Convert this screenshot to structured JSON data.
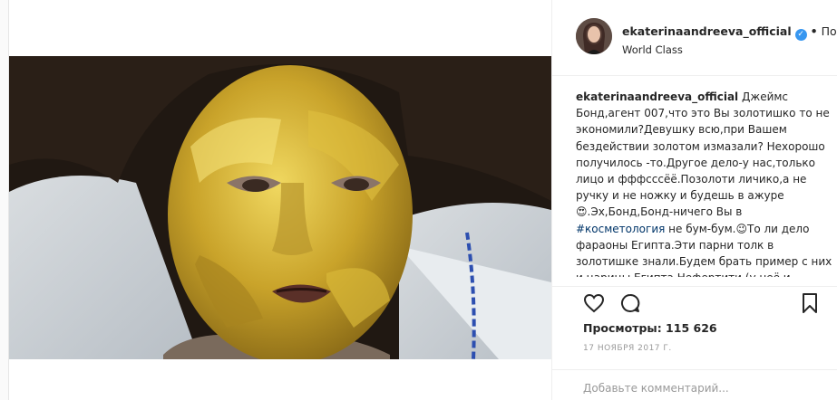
{
  "post": {
    "username": "ekaterinaandreeva_official",
    "follow_separator": "•",
    "follow_label": "Подпи",
    "location": "World Class",
    "caption_segments": [
      "Джеймс Бонд,агент 007,что это Вы золотишко то не экономили?Девушку всю,при Вашем бездействии золотом измазали? Нехорошо получилось -то.",
      "Другое дело-у нас,только лицо и фффсссёё.Позолоти личико,а не ручку и не ножку и будешь в ажуре",
      ".Эх,Бонд,Бонд-ничего Вы в ",
      " не бум-бум.",
      "То ли дело фараоны Египта.Эти парни толк в золотишке знали.Будем брать пример с них и царицы Египта Нефертити (у неё и"
    ],
    "hashtag": "#косметология",
    "emoji_1": "😍",
    "emoji_2": "😉",
    "views_label": "Просмотры: 115 626",
    "date": "17 НОЯБРЯ 2017 Г.",
    "comment_placeholder": "Добавьте комментарий..."
  },
  "icons": {
    "verified": "verified-badge-icon",
    "like": "heart-icon",
    "comment": "comment-icon",
    "save": "bookmark-icon"
  },
  "colors": {
    "verified": "#3897f0",
    "hashtag": "#003569",
    "muted": "#999999",
    "text": "#262626",
    "gold": "#c8a230"
  }
}
